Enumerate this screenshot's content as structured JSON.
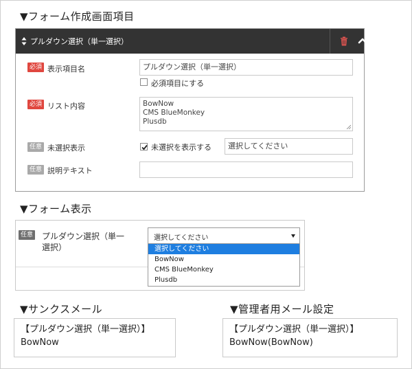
{
  "sections": {
    "builder_title": "▼フォーム作成画面項目",
    "display_title": "▼フォーム表示",
    "thanks_title": "▼サンクスメール",
    "admin_title": "▼管理者用メール設定"
  },
  "builder": {
    "header_title": "プルダウン選択（単一選択）",
    "badges": {
      "required": "必須",
      "optional": "任意"
    },
    "fields": {
      "item_name_label": "表示項目名",
      "item_name_value": "プルダウン選択（単一選択）",
      "required_checkbox_label": "必須項目にする",
      "list_label": "リスト内容",
      "list_lines": [
        "BowNow",
        "CMS BlueMonkey",
        "Plusdb"
      ],
      "unselected_label": "未選択表示",
      "unselected_checkbox_label": "未選択を表示する",
      "unselected_text_value": "選択してください",
      "desc_label": "説明テキスト",
      "desc_value": ""
    },
    "unselected_checked": true,
    "required_checked": false
  },
  "display": {
    "badge": "任意",
    "label": "プルダウン選択（単一選択）",
    "selected": "選択してください",
    "options": [
      "選択してください",
      "BowNow",
      "CMS BlueMonkey",
      "Plusdb"
    ],
    "highlighted_index": 0
  },
  "thanks_mail": {
    "line1": "【プルダウン選択（単一選択）】",
    "line2": "BowNow"
  },
  "admin_mail": {
    "line1": "【プルダウン選択（単一選択）】",
    "line2": "BowNow(BowNow)"
  },
  "colors": {
    "header_bg": "#333333",
    "required_badge": "#e0473f",
    "optional_badge": "#a9a9a9",
    "highlight": "#1e7ee0",
    "trash_icon": "#d9534f"
  }
}
